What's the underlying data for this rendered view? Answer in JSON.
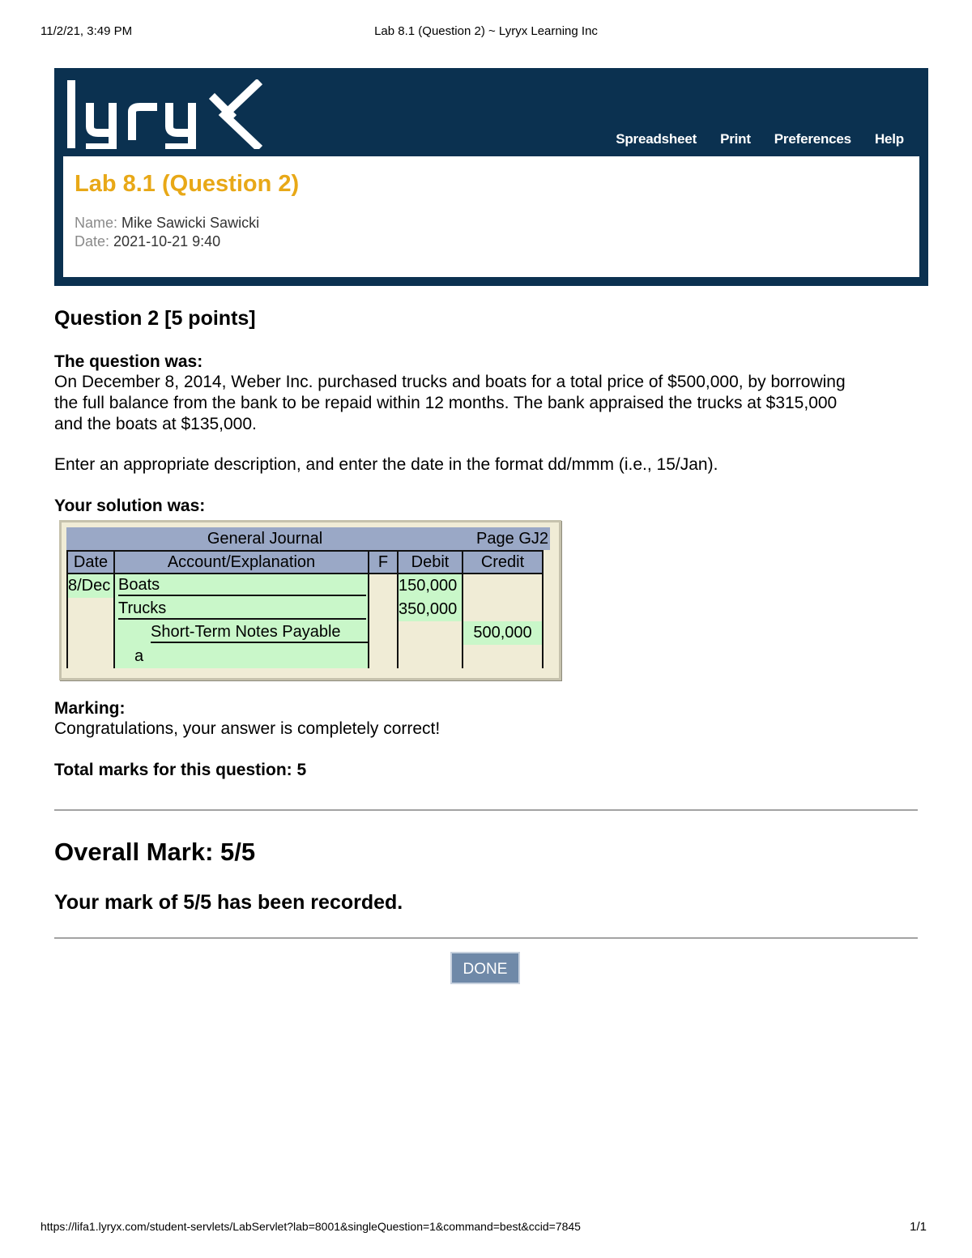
{
  "print_header": {
    "datetime": "11/2/21, 3:49 PM",
    "page_title": "Lab 8.1 (Question 2) ~ Lyryx Learning Inc"
  },
  "banner": {
    "logo_text": "lyryx",
    "nav": [
      "Spreadsheet",
      "Print",
      "Preferences",
      "Help"
    ],
    "lab_title": "Lab 8.1 (Question 2)",
    "name_label": "Name:",
    "name_value": "Mike Sawicki Sawicki",
    "date_label": "Date:",
    "date_value": "2021-10-21 9:40"
  },
  "question": {
    "heading": "Question 2 [5 points]",
    "was_label": "The question was:",
    "text_lines": [
      "On December 8, 2014, Weber Inc. purchased trucks and boats for a total price of $500,000, by borrowing",
      "the full balance from the bank to be repaid within 12 months. The bank appraised the trucks at $315,000",
      "and the boats at $135,000."
    ],
    "instruction": "Enter an appropriate description, and enter the date in the format dd/mmm (i.e., 15/Jan).",
    "solution_label": "Your solution was:"
  },
  "journal": {
    "title": "General Journal",
    "page": "Page GJ2",
    "columns": [
      "Date",
      "Account/Explanation",
      "F",
      "Debit",
      "Credit"
    ],
    "rows": [
      {
        "date": "8/Dec",
        "account": "Boats",
        "f": "",
        "debit": "150,000",
        "credit": ""
      },
      {
        "date": "",
        "account": "Trucks",
        "f": "",
        "debit": "350,000",
        "credit": ""
      },
      {
        "date": "",
        "account": "Short-Term Notes Payable",
        "f": "",
        "debit": "",
        "credit": "500,000"
      },
      {
        "date": "",
        "account": "a",
        "f": "",
        "debit": "",
        "credit": ""
      }
    ]
  },
  "marking": {
    "label": "Marking:",
    "text": "Congratulations, your answer is completely correct!",
    "total": "Total marks for this question: 5"
  },
  "overall": {
    "title": "Overall Mark: 5/5",
    "recorded": "Your mark of 5/5 has been recorded.",
    "done_label": "DONE"
  },
  "print_footer": {
    "url": "https://lifa1.lyryx.com/student-servlets/LabServlet?lab=8001&singleQuestion=1&command=best&ccid=7845",
    "page_count": "1/1"
  },
  "colors": {
    "banner": "#0b3150",
    "title_accent": "#e8a817",
    "journal_header": "#9aa8c6",
    "journal_bg": "#f0ecd6",
    "journal_input": "#c9f7c9",
    "done_button": "#6f89a8"
  }
}
